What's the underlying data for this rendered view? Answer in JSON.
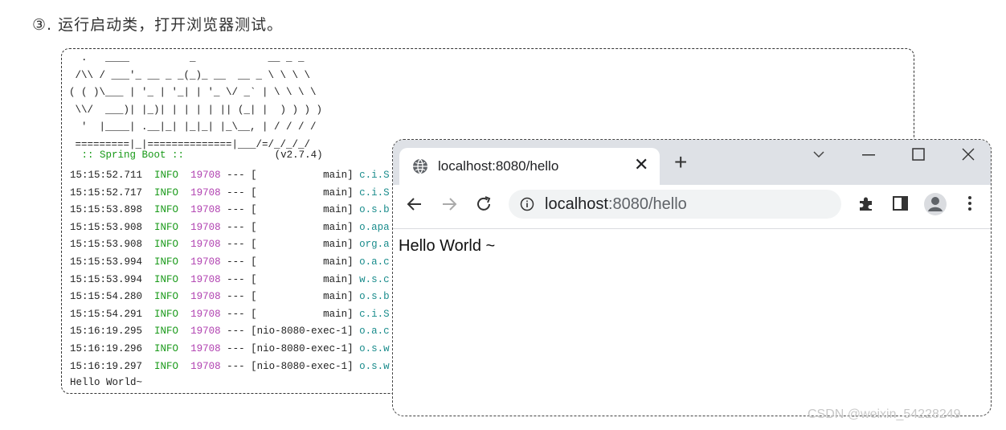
{
  "doc": {
    "step_text": "③. 运行启动类，打开浏览器测试。"
  },
  "console": {
    "banner_lines": [
      "  .   ____          _            __ _ _",
      " /\\\\ / ___'_ __ _ _(_)_ __  __ _ \\ \\ \\ \\",
      "( ( )\\___ | '_ | '_| | '_ \\/ _` | \\ \\ \\ \\",
      " \\\\/  ___)| |_)| | | | | || (_| |  ) ) ) )",
      "  '  |____| .__|_| |_|_| |_\\__, | / / / /",
      " =========|_|==============|___/=/_/_/_/"
    ],
    "spring_boot_label": " :: Spring Boot ::",
    "spring_boot_version": "(v2.7.4)",
    "logs": [
      {
        "time": "15:15:52.711",
        "level": "INFO",
        "pid": "19708",
        "sep": " --- ",
        "thread": "[           main]",
        "cls": "c.i.S"
      },
      {
        "time": "15:15:52.717",
        "level": "INFO",
        "pid": "19708",
        "sep": " --- ",
        "thread": "[           main]",
        "cls": "c.i.S"
      },
      {
        "time": "15:15:53.898",
        "level": "INFO",
        "pid": "19708",
        "sep": " --- ",
        "thread": "[           main]",
        "cls": "o.s.b"
      },
      {
        "time": "15:15:53.908",
        "level": "INFO",
        "pid": "19708",
        "sep": " --- ",
        "thread": "[           main]",
        "cls": "o.apa"
      },
      {
        "time": "15:15:53.908",
        "level": "INFO",
        "pid": "19708",
        "sep": " --- ",
        "thread": "[           main]",
        "cls": "org.a"
      },
      {
        "time": "15:15:53.994",
        "level": "INFO",
        "pid": "19708",
        "sep": " --- ",
        "thread": "[           main]",
        "cls": "o.a.c"
      },
      {
        "time": "15:15:53.994",
        "level": "INFO",
        "pid": "19708",
        "sep": " --- ",
        "thread": "[           main]",
        "cls": "w.s.c"
      },
      {
        "time": "15:15:54.280",
        "level": "INFO",
        "pid": "19708",
        "sep": " --- ",
        "thread": "[           main]",
        "cls": "o.s.b"
      },
      {
        "time": "15:15:54.291",
        "level": "INFO",
        "pid": "19708",
        "sep": " --- ",
        "thread": "[           main]",
        "cls": "c.i.S"
      },
      {
        "time": "15:16:19.295",
        "level": "INFO",
        "pid": "19708",
        "sep": " --- ",
        "thread": "[nio-8080-exec-1]",
        "cls": "o.a.c"
      },
      {
        "time": "15:16:19.296",
        "level": "INFO",
        "pid": "19708",
        "sep": " --- ",
        "thread": "[nio-8080-exec-1]",
        "cls": "o.s.w"
      },
      {
        "time": "15:16:19.297",
        "level": "INFO",
        "pid": "19708",
        "sep": " --- ",
        "thread": "[nio-8080-exec-1]",
        "cls": "o.s.w"
      }
    ],
    "last_line": "Hello World~"
  },
  "browser": {
    "tab_title": "localhost:8080/hello",
    "url_host": "localhost",
    "url_path": ":8080/hello",
    "page_text": "Hello World ~",
    "icons": [
      "globe-icon",
      "close-icon",
      "plus-icon",
      "chevron-down-icon",
      "minimize-icon",
      "maximize-icon",
      "window-close-icon",
      "back-arrow-icon",
      "forward-arrow-icon",
      "reload-icon",
      "info-icon",
      "extensions-puzzle-icon",
      "side-panel-icon",
      "profile-avatar-icon",
      "more-vert-icon"
    ]
  },
  "watermark": "CSDN @weixin_54228249"
}
